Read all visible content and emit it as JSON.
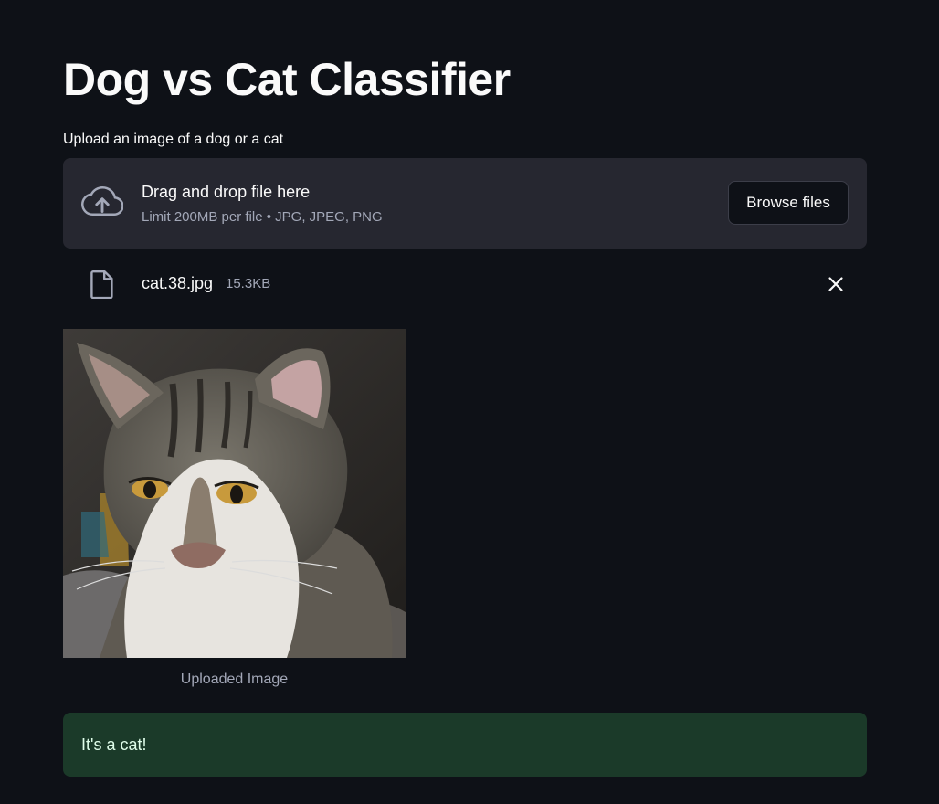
{
  "app": {
    "title": "Dog vs Cat Classifier"
  },
  "uploader": {
    "label": "Upload an image of a dog or a cat",
    "drop_title": "Drag and drop file here",
    "drop_subtitle": "Limit 200MB per file • JPG, JPEG, PNG",
    "browse_label": "Browse files",
    "icon": "cloud-upload-icon"
  },
  "uploaded_file": {
    "name": "cat.38.jpg",
    "size": "15.3KB",
    "icon": "file-icon",
    "remove_icon": "close-icon"
  },
  "image": {
    "caption": "Uploaded Image"
  },
  "result": {
    "message": "It's a cat!",
    "background_color": "#1b3a29",
    "text_color": "#dffde9"
  },
  "theme": {
    "background": "#0e1117",
    "surface": "#262730",
    "text": "#fafafa",
    "muted_text": "#a3a8b8"
  }
}
